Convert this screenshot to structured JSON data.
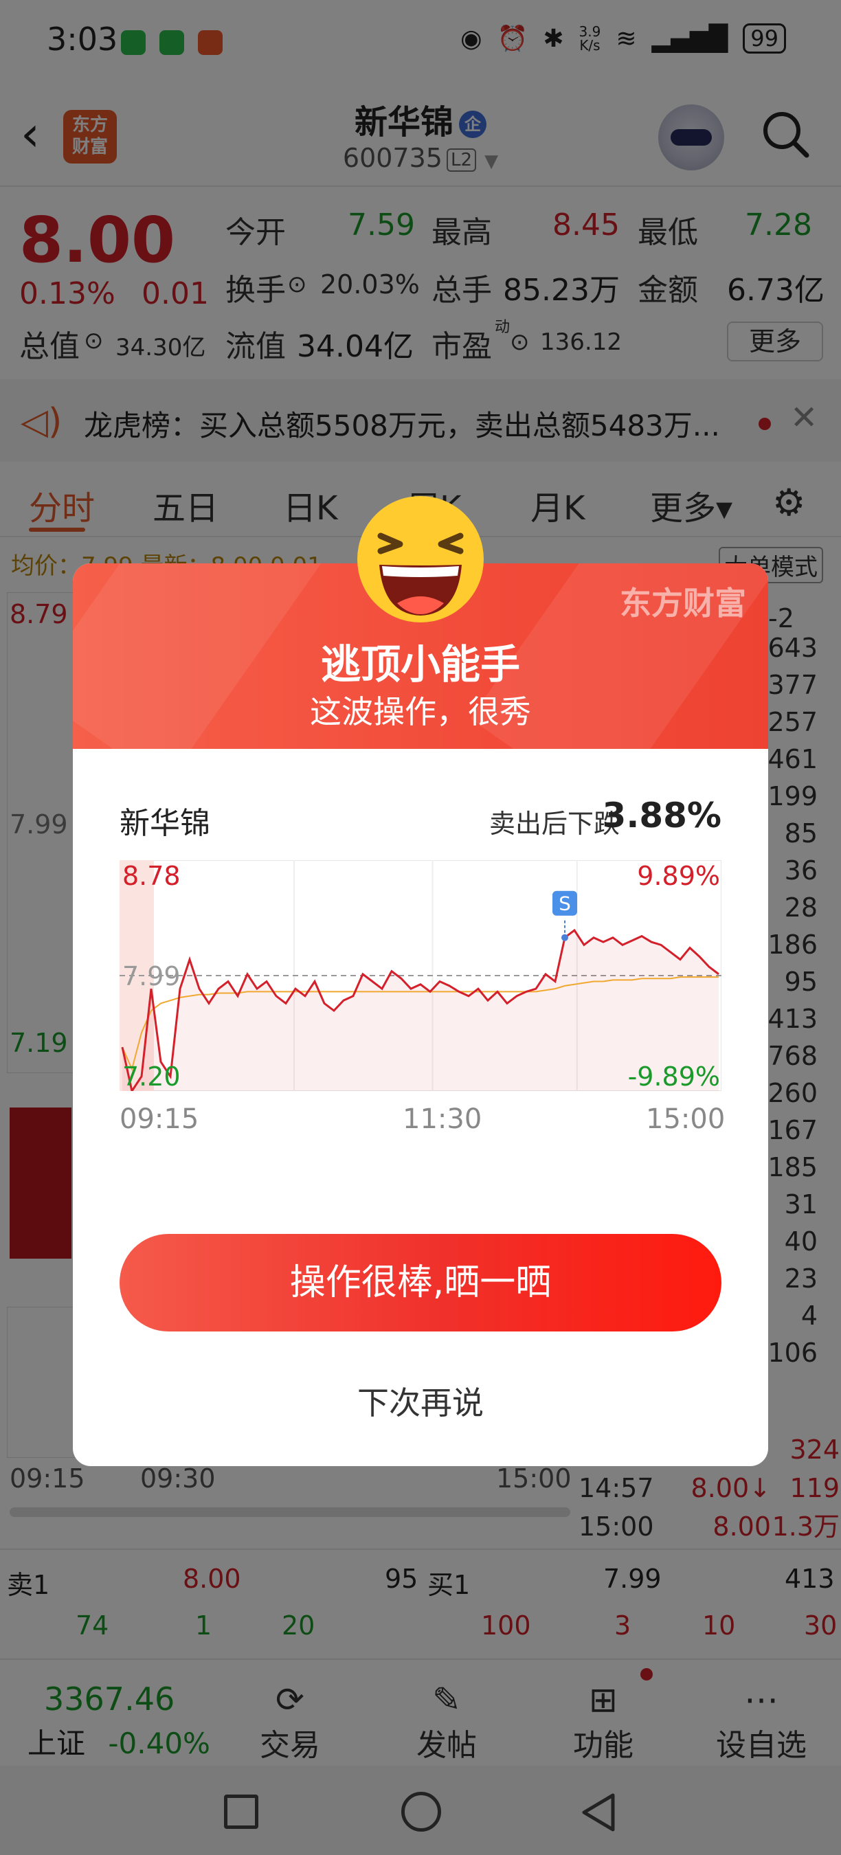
{
  "status": {
    "time": "3:03",
    "net_speed": "3.9\nK/s",
    "net_speed_top": "3.9",
    "net_speed_bottom": "K/s",
    "battery": "99"
  },
  "header": {
    "logo_text_1": "东方",
    "logo_text_2": "财富",
    "stock_name": "新华锦",
    "stock_badge": "企",
    "stock_code": "600735",
    "level": "L2"
  },
  "quote": {
    "price": "8.00",
    "change_pct": "0.13%",
    "change": "0.01",
    "open_label": "今开",
    "open": "7.59",
    "high_label": "最高",
    "high": "8.45",
    "low_label": "最低",
    "low": "7.28",
    "turnover_label": "换手",
    "turnover": "20.03%",
    "volume_label": "总手",
    "volume": "85.23万",
    "amount_label": "金额",
    "amount": "6.73亿",
    "mktcap_label": "总值",
    "mktcap": "34.30亿",
    "float_label": "流值",
    "float": "34.04亿",
    "pe_label": "市盈",
    "pe_sup": "动",
    "pe": "136.12",
    "more": "更多"
  },
  "news": {
    "text": "龙虎榜：买入总额5508万元，卖出总额5483万..."
  },
  "tabs": [
    {
      "label": "分时"
    },
    {
      "label": "五日"
    },
    {
      "label": "日K"
    },
    {
      "label": "周K"
    },
    {
      "label": "月K"
    },
    {
      "label": "更多▾"
    }
  ],
  "bg": {
    "avg_label": "均价：7.99 最新：8.00 0.01",
    "mode": "大单模式",
    "top_price": "8.79",
    "mid_price": "7.99",
    "low_price": "7.19",
    "t_start": "09:15",
    "t_930": "09:30",
    "t_end": "15:00",
    "side_index": "-2",
    "side_values": [
      "643",
      "377",
      "257",
      "461",
      "199",
      "85",
      "36",
      "28",
      "186",
      "95",
      "413",
      "768",
      "260",
      "167",
      "185",
      "31",
      "40",
      "23",
      "4",
      "106"
    ],
    "ticks": [
      {
        "time": "",
        "price": "",
        "vol": "324"
      },
      {
        "time": "14:57",
        "price": "8.00↓",
        "vol": "119"
      },
      {
        "time": "15:00",
        "price": "8.00",
        "vol": "1.3万"
      }
    ]
  },
  "book": {
    "sell1_label": "卖1",
    "sell1_price": "8.00",
    "sell1_vol": "95",
    "buy1_label": "买1",
    "buy1_price": "7.99",
    "buy1_vol": "413",
    "sell_row": [
      "74",
      "1",
      "20"
    ],
    "buy_row": [
      "100",
      "3",
      "10",
      "30"
    ]
  },
  "tabbar": {
    "index_value": "3367.46",
    "index_name": "上证",
    "index_change": "-0.40%",
    "trade": "交易",
    "post": "发帖",
    "function": "功能",
    "watch": "设自选"
  },
  "modal": {
    "brand": "东方财富",
    "title": "逃顶小能手",
    "subtitle": "这波操作，很秀",
    "stock_name": "新华锦",
    "drop_label": "卖出后下跌",
    "drop_value": "3.88%",
    "share_button": "操作很棒,晒一晒",
    "later_button": "下次再说",
    "sell_marker": "S"
  },
  "chart_data": {
    "type": "line",
    "title": "",
    "y_left_top": "8.78",
    "y_left_mid": "7.99",
    "y_left_bottom": "7.20",
    "y_right_top": "9.89%",
    "y_right_bottom": "-9.89%",
    "x_labels": [
      "09:15",
      "11:30",
      "15:00"
    ],
    "ylim": [
      7.2,
      8.78
    ],
    "prev_close": 7.99,
    "series": [
      {
        "name": "",
        "values": [
          7.5,
          7.2,
          7.3,
          7.9,
          7.4,
          7.3,
          7.9,
          8.1,
          7.9,
          7.8,
          7.9,
          7.95,
          7.85,
          8.0,
          7.9,
          7.95,
          7.85,
          7.8,
          7.9,
          7.85,
          7.95,
          7.8,
          7.75,
          7.82,
          7.85,
          8.0,
          7.95,
          7.9,
          8.02,
          7.97,
          7.9,
          7.93,
          7.88,
          7.95,
          7.92,
          7.88,
          7.85,
          7.9,
          7.82,
          7.88,
          7.8,
          7.85,
          7.88,
          7.9,
          8.0,
          7.95,
          8.25,
          8.3,
          8.2,
          8.25,
          8.22,
          8.25,
          8.2,
          8.23,
          8.26,
          8.22,
          8.2,
          8.15,
          8.1,
          8.18,
          8.12,
          8.05,
          8.0
        ]
      },
      {
        "name": "",
        "values": [
          7.5,
          7.35,
          7.6,
          7.75,
          7.8,
          7.82,
          7.84,
          7.85,
          7.86,
          7.86,
          7.87,
          7.87,
          7.87,
          7.88,
          7.88,
          7.88,
          7.88,
          7.88,
          7.88,
          7.88,
          7.88,
          7.88,
          7.88,
          7.88,
          7.88,
          7.88,
          7.88,
          7.88,
          7.88,
          7.88,
          7.88,
          7.88,
          7.88,
          7.88,
          7.88,
          7.88,
          7.88,
          7.88,
          7.88,
          7.88,
          7.88,
          7.88,
          7.88,
          7.88,
          7.89,
          7.9,
          7.92,
          7.93,
          7.94,
          7.95,
          7.95,
          7.96,
          7.96,
          7.96,
          7.97,
          7.97,
          7.97,
          7.97,
          7.98,
          7.98,
          7.98,
          7.98,
          7.98
        ]
      }
    ],
    "sell_index": 46,
    "colors": {
      "price": "#d3202a",
      "avg": "#f0a830"
    }
  },
  "colors": {
    "accent": "#e35a2a",
    "up": "#d3202a",
    "down": "#1a9a2a"
  }
}
